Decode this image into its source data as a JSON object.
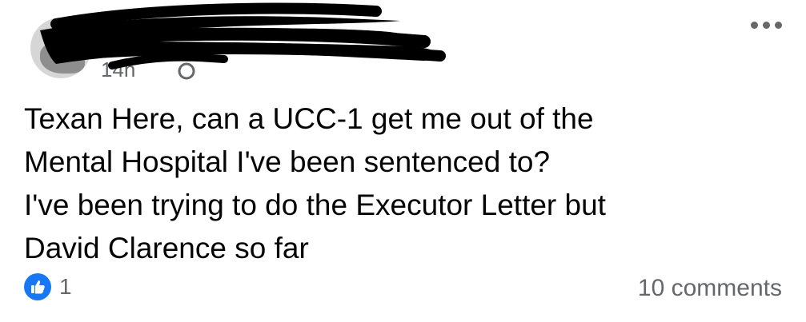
{
  "post": {
    "time": "14h",
    "privacy_icon": "globe-icon",
    "more_icon": "more-options-icon",
    "text_lines": [
      "Texan Here, can a UCC-1 get me out of the",
      "Mental Hospital I've been sentenced to?",
      "I've been trying to do the Executor Letter but",
      "David Clarence so far"
    ],
    "reaction_icon": "like-icon",
    "reaction_count": "1",
    "comments": "10 comments"
  },
  "colors": {
    "text": "#050505",
    "secondary": "#65676b",
    "like_blue": "#1877f2",
    "redaction": "#000000"
  }
}
